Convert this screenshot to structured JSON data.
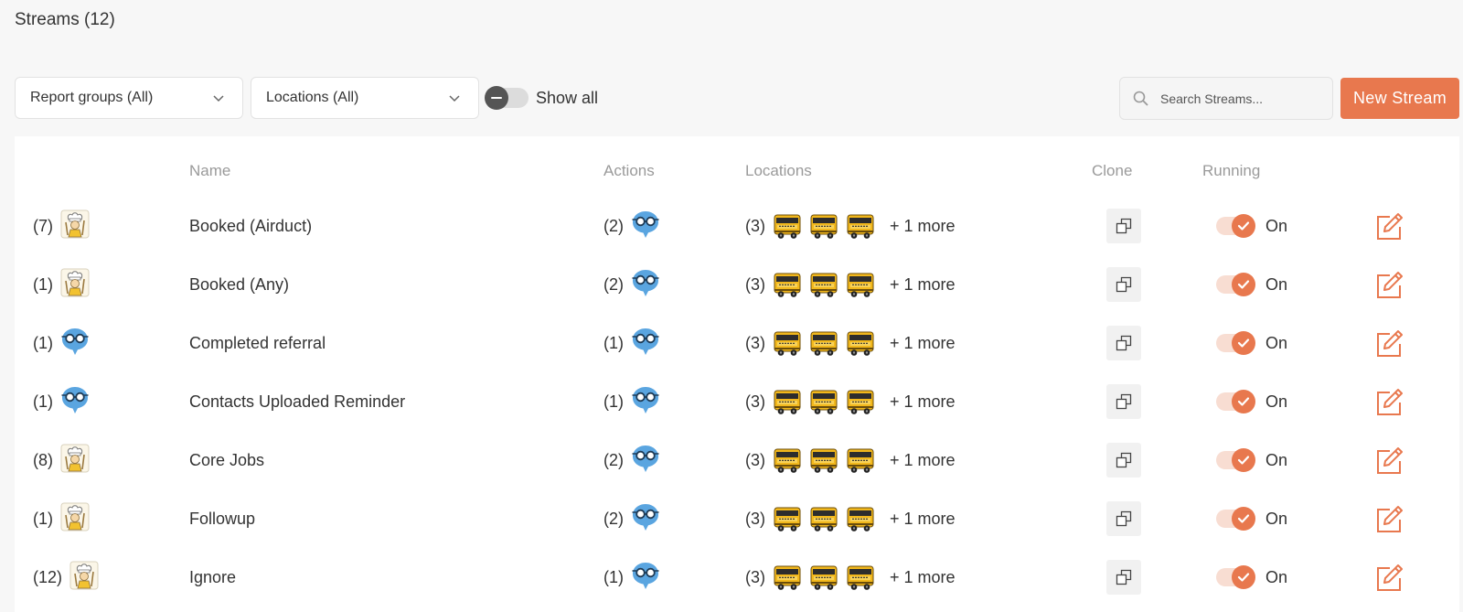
{
  "page": {
    "title": "Streams (12)"
  },
  "filters": {
    "report_groups": "Report groups (All)",
    "locations": "Locations (All)",
    "show_all_label": "Show all"
  },
  "search": {
    "placeholder": "Search Streams..."
  },
  "new_stream_label": "New Stream",
  "table": {
    "headers": {
      "name": "Name",
      "actions": "Actions",
      "locations": "Locations",
      "clone": "Clone",
      "running": "Running"
    },
    "rows": [
      {
        "count": "(7)",
        "avatar": "chef",
        "name": "Booked (Airduct)",
        "actions_count": "(2)",
        "locations_count": "(3)",
        "more": "+ 1 more",
        "running": "On"
      },
      {
        "count": "(1)",
        "avatar": "chef",
        "name": "Booked (Any)",
        "actions_count": "(2)",
        "locations_count": "(3)",
        "more": "+ 1 more",
        "running": "On"
      },
      {
        "count": "(1)",
        "avatar": "glasses",
        "name": "Completed referral",
        "actions_count": "(1)",
        "locations_count": "(3)",
        "more": "+ 1 more",
        "running": "On"
      },
      {
        "count": "(1)",
        "avatar": "glasses",
        "name": "Contacts Uploaded Reminder",
        "actions_count": "(1)",
        "locations_count": "(3)",
        "more": "+ 1 more",
        "running": "On"
      },
      {
        "count": "(8)",
        "avatar": "chef",
        "name": "Core Jobs",
        "actions_count": "(2)",
        "locations_count": "(3)",
        "more": "+ 1 more",
        "running": "On"
      },
      {
        "count": "(1)",
        "avatar": "chef",
        "name": "Followup",
        "actions_count": "(2)",
        "locations_count": "(3)",
        "more": "+ 1 more",
        "running": "On"
      },
      {
        "count": "(12)",
        "avatar": "chef",
        "name": "Ignore",
        "actions_count": "(1)",
        "locations_count": "(3)",
        "more": "+ 1 more",
        "running": "On"
      }
    ]
  },
  "icons": {
    "search": "search-icon",
    "chevron": "chevron-down-icon",
    "clone": "clone-icon",
    "edit": "edit-icon",
    "check": "check-icon",
    "action": "glasses-bubble-icon",
    "location": "school-bus-icon"
  },
  "colors": {
    "accent": "#e8784e",
    "bubble": "#5aa5e0",
    "bus": "#f2b81c"
  }
}
